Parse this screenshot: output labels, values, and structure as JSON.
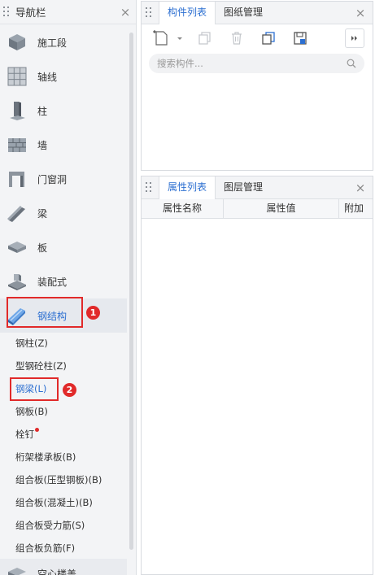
{
  "nav": {
    "title": "导航栏",
    "categories": [
      {
        "label": "施工段",
        "icon": "construction-section-icon"
      },
      {
        "label": "轴线",
        "icon": "grid-axis-icon"
      },
      {
        "label": "柱",
        "icon": "column-icon"
      },
      {
        "label": "墙",
        "icon": "wall-icon"
      },
      {
        "label": "门窗洞",
        "icon": "door-window-icon"
      },
      {
        "label": "梁",
        "icon": "beam-icon"
      },
      {
        "label": "板",
        "icon": "slab-icon"
      },
      {
        "label": "装配式",
        "icon": "prefab-icon"
      },
      {
        "label": "钢结构",
        "icon": "steel-structure-icon"
      }
    ],
    "sub_items": [
      "钢柱(Z)",
      "型钢砼柱(Z)",
      "钢梁(L)",
      "钢板(B)",
      "栓钉",
      "桁架楼承板(B)",
      "组合板(压型钢板)(B)",
      "组合板(混凝土)(B)",
      "组合板受力筋(S)",
      "组合板负筋(F)"
    ],
    "bottom_partial": "空心楼盖",
    "active_category": "钢结构",
    "selected_sub": "钢梁(L)"
  },
  "annotations": {
    "badge1": "1",
    "badge2": "2"
  },
  "component_panel": {
    "tabs": [
      "构件列表",
      "图纸管理"
    ],
    "active_tab": "构件列表",
    "search_placeholder": "搜索构件..."
  },
  "property_panel": {
    "tabs": [
      "属性列表",
      "图层管理"
    ],
    "active_tab": "属性列表",
    "columns": [
      "属性名称",
      "属性值",
      "附加"
    ]
  },
  "colors": {
    "accent": "#2c6fd1",
    "annotation_red": "#e12a2a"
  }
}
